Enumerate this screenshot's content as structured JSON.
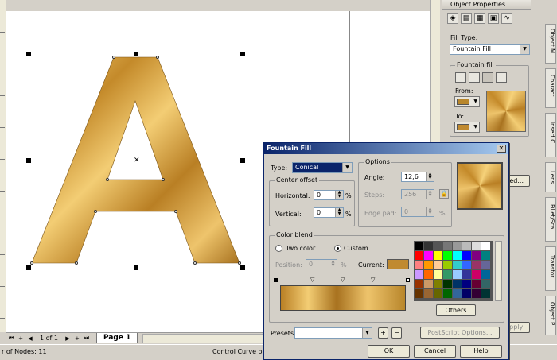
{
  "docker": {
    "title": "Object Properties",
    "fill_type_label": "Fill Type:",
    "fill_type_value": "Fountain Fill",
    "fountain_fill_label": "Fountain fill",
    "from_label": "From:",
    "to_label": "To:",
    "advanced_button": "ced...",
    "apply_button": "Apply",
    "from_color": "#b8862b",
    "to_color": "#c08a30"
  },
  "side_tabs": [
    "Object M...",
    "Charact...",
    "Insert C...",
    "Lens",
    "Fillet/Sca...",
    "Transfor...",
    "Object P..."
  ],
  "canvas": {
    "page_counter": "1 of 1",
    "page_tab": "Page 1"
  },
  "status": {
    "left": "r of Nodes: 11",
    "right": "Control Curve on"
  },
  "dialog": {
    "title": "Fountain Fill",
    "close": "✕",
    "type_label": "Type:",
    "type_value": "Conical",
    "center_offset_label": "Center offset",
    "horizontal_label": "Horizontal:",
    "horizontal_value": "0",
    "vertical_label": "Vertical:",
    "vertical_value": "0",
    "percent": "%",
    "options_label": "Options",
    "angle_label": "Angle:",
    "angle_value": "12,6",
    "steps_label": "Steps:",
    "steps_value": "256",
    "edge_pad_label": "Edge pad:",
    "edge_pad_value": "0",
    "color_blend_label": "Color blend",
    "two_color_label": "Two color",
    "custom_label": "Custom",
    "position_label": "Position:",
    "position_value": "0",
    "current_label": "Current:",
    "current_color": "#c08a30",
    "others_button": "Others",
    "presets_label": "Presets:",
    "presets_value": "",
    "postscript_button": "PostScript Options...",
    "ok_button": "OK",
    "cancel_button": "Cancel",
    "help_button": "Help",
    "add_preset": "+",
    "remove_preset": "−"
  }
}
